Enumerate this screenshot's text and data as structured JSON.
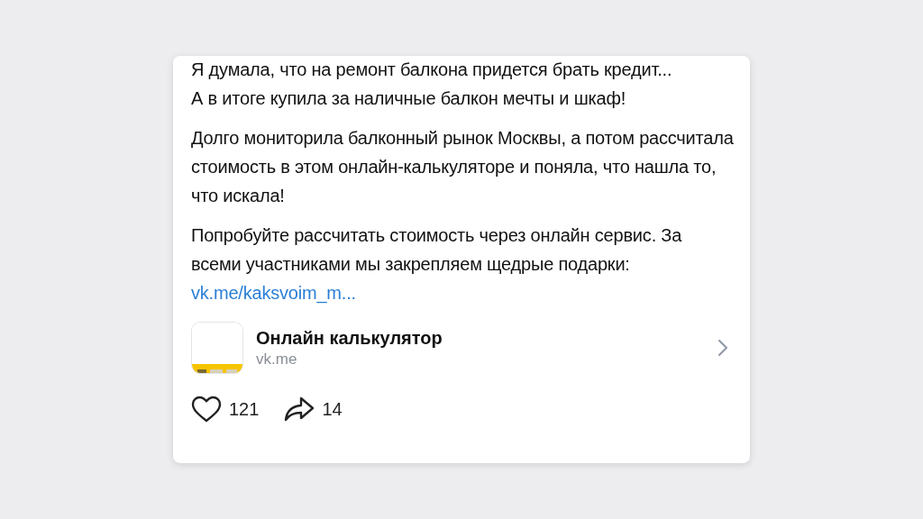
{
  "post": {
    "paragraphs": [
      [
        "Я думала, что на ремонт балкона придется брать кредит...",
        "А в итоге купила за наличные балкон мечты и шкаф!"
      ],
      [
        "Долго мониторила балконный рынок Москвы, а потом рассчитала стоимость в этом онлайн-калькуляторе и поняла, что нашла то, что искала!"
      ],
      [
        "Попробуйте рассчитать стоимость через онлайн сервис. За всеми участниками мы закрепляем щедрые подарки:"
      ]
    ],
    "link": "vk.me/kaksvoim_m...",
    "attachment": {
      "kind": "picture",
      "title": "Онлайн калькулятор",
      "subtitle": "vk.me"
    },
    "likes": "121",
    "shares": "14"
  }
}
